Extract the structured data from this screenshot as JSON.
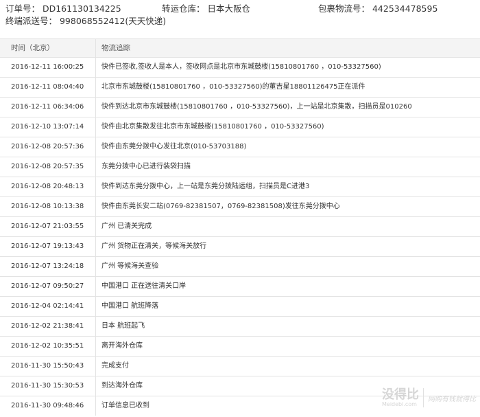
{
  "header": {
    "order_no": "订单号： DD161130134225",
    "warehouse": "转运仓库： 日本大阪仓",
    "parcel_no": "包裹物流号： 442534478595",
    "delivery_no": "终端派送号： 998068552412(天天快递)"
  },
  "table": {
    "col_time": "时间（北京）",
    "col_track": "物流追踪",
    "rows": [
      {
        "time": "2016-12-11 16:00:25",
        "info": "快件已签收,签收人是本人，签收网点是北京市东城鼓楼(15810801760 ，010-53327560)"
      },
      {
        "time": "2016-12-11 08:04:40",
        "info": "北京市东城鼓楼(15810801760 ，010-53327560)的董吉星18801126475正在派件"
      },
      {
        "time": "2016-12-11 06:34:06",
        "info": "快件到达北京市东城鼓楼(15810801760 ，010-53327560)，上一站是北京集散，扫描员是010260"
      },
      {
        "time": "2016-12-10 13:07:14",
        "info": "快件由北京集散发往北京市东城鼓楼(15810801760 ，010-53327560)"
      },
      {
        "time": "2016-12-08 20:57:36",
        "info": "快件由东莞分拨中心发往北京(010-53703188)"
      },
      {
        "time": "2016-12-08 20:57:35",
        "info": "东莞分拨中心已进行装袋扫描"
      },
      {
        "time": "2016-12-08 20:48:13",
        "info": "快件到达东莞分拨中心，上一站是东莞分拨陆运组，扫描员是C进港3"
      },
      {
        "time": "2016-12-08 10:13:38",
        "info": "快件由东莞长安二站(0769-82381507，0769-82381508)发往东莞分拨中心"
      },
      {
        "time": "2016-12-07 21:03:55",
        "info": "广州 已清关完成"
      },
      {
        "time": "2016-12-07 19:13:43",
        "info": "广州 货物正在清关，等候海关放行"
      },
      {
        "time": "2016-12-07 13:24:18",
        "info": "广州 等候海关查验"
      },
      {
        "time": "2016-12-07 09:50:27",
        "info": "中国港口 正在送往清关口岸"
      },
      {
        "time": "2016-12-04 02:14:41",
        "info": "中国港口 航班降落"
      },
      {
        "time": "2016-12-02 21:38:41",
        "info": "日本 航班起飞"
      },
      {
        "time": "2016-12-02 10:35:51",
        "info": "离开海外仓库"
      },
      {
        "time": "2016-11-30 15:50:43",
        "info": "完成支付"
      },
      {
        "time": "2016-11-30 15:30:53",
        "info": "到达海外仓库"
      },
      {
        "time": "2016-11-30 09:48:46",
        "info": "订单信息已收到"
      }
    ]
  },
  "watermark": {
    "logo": "没得比",
    "site": "Meidebi.com",
    "slogan": "网购有钱就得比"
  }
}
